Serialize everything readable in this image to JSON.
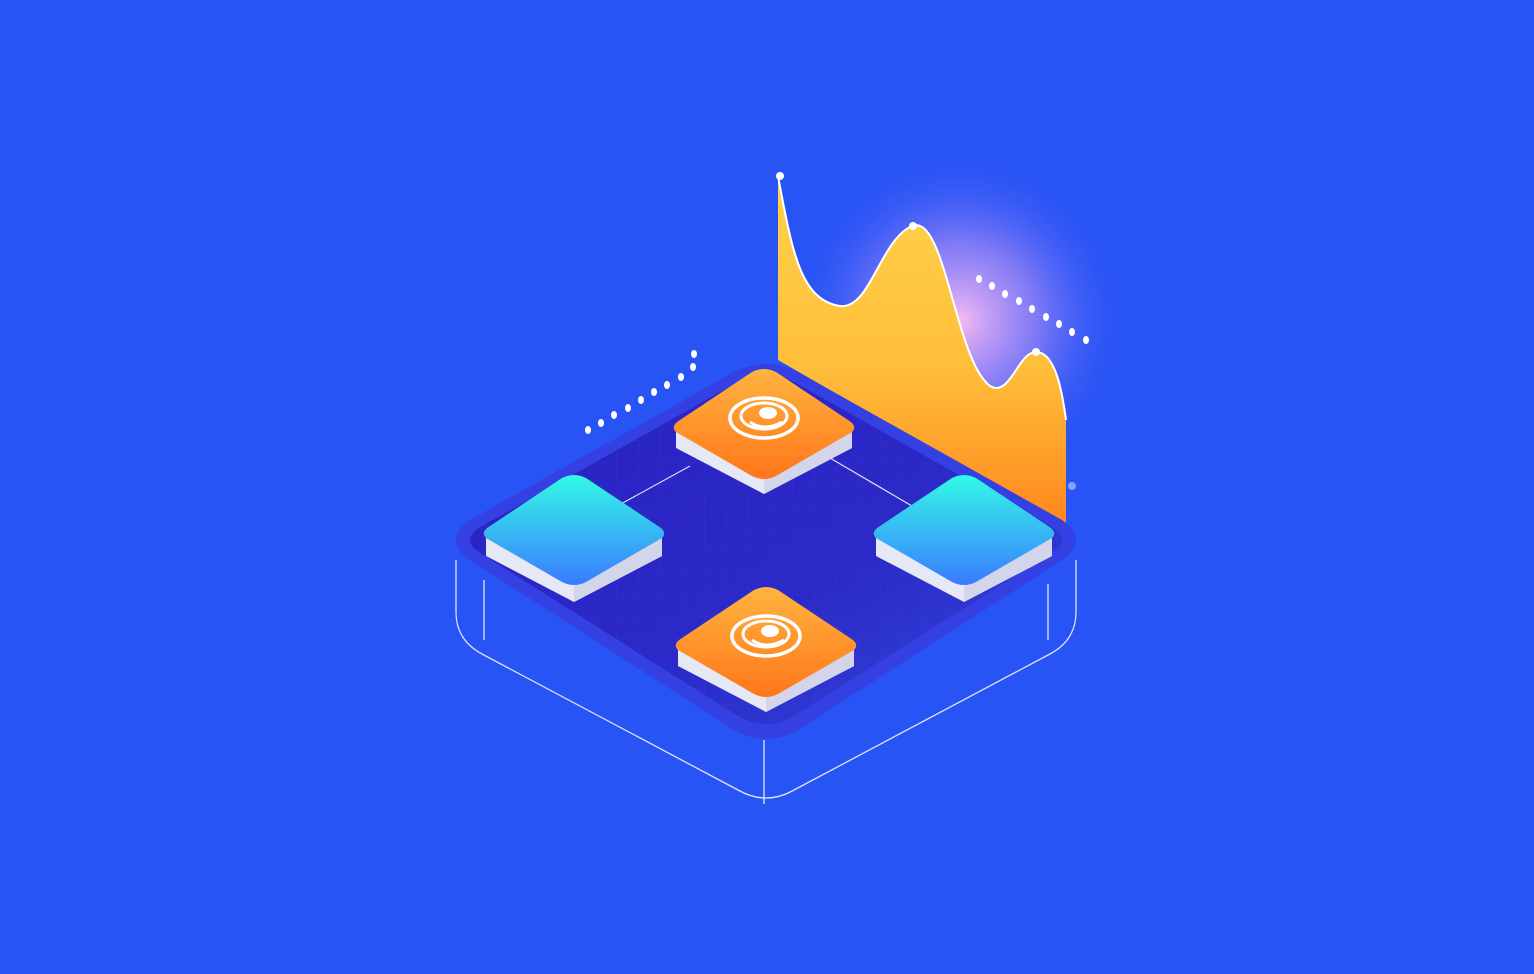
{
  "colors": {
    "background": "#2853f5",
    "platform_top": "#2a22c4",
    "platform_rim": "#3a3fe0",
    "outline": "#ffffff",
    "tile_orange_light": "#ffb340",
    "tile_orange_dark": "#ff7a1c",
    "tile_cyan_light": "#2ff8e8",
    "tile_cyan_dark": "#3a7dff",
    "tile_side": "#e6e8f5",
    "wave_light": "#ffd24a",
    "wave_dark": "#ff8a1e",
    "glow": "#ffb6f0"
  },
  "illustration": {
    "tiles": [
      {
        "name": "orange-tile-top",
        "color": "orange",
        "icon": "gauge-icon"
      },
      {
        "name": "cyan-tile-left",
        "color": "cyan",
        "icon": ""
      },
      {
        "name": "cyan-tile-right",
        "color": "cyan",
        "icon": ""
      },
      {
        "name": "orange-tile-bottom",
        "color": "orange",
        "icon": "gauge-icon"
      }
    ],
    "decorations": [
      "dotted-line-left",
      "dotted-line-right",
      "wave-chart-panel",
      "grid-floor"
    ]
  }
}
